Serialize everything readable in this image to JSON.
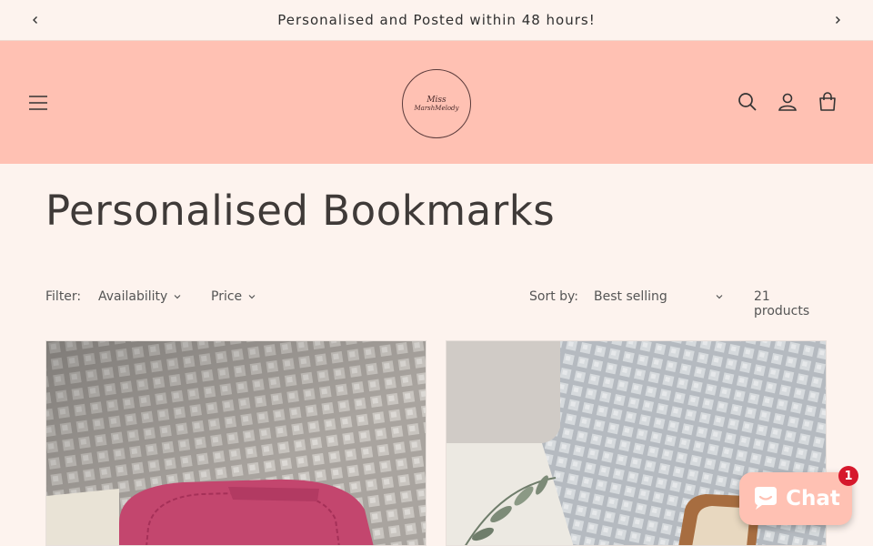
{
  "announcement": {
    "text": "Personalised and Posted within 48 hours!",
    "prev_icon": "chevron-left-icon",
    "next_icon": "chevron-right-icon"
  },
  "header": {
    "background": "#ffc1b3",
    "logo": {
      "line1": "Miss",
      "line2": "MarshMelody"
    },
    "icons": [
      "menu-icon",
      "search-icon",
      "account-icon",
      "cart-icon"
    ]
  },
  "collection": {
    "title": "Personalised Bookmarks"
  },
  "filters": {
    "filter_label": "Filter:",
    "availability_label": "Availability",
    "price_label": "Price",
    "sort_label": "Sort by:",
    "sort_value": "Best selling",
    "product_count": "21 products"
  },
  "chat": {
    "label": "Chat",
    "badge": "1",
    "badge_color": "#d6182c"
  }
}
